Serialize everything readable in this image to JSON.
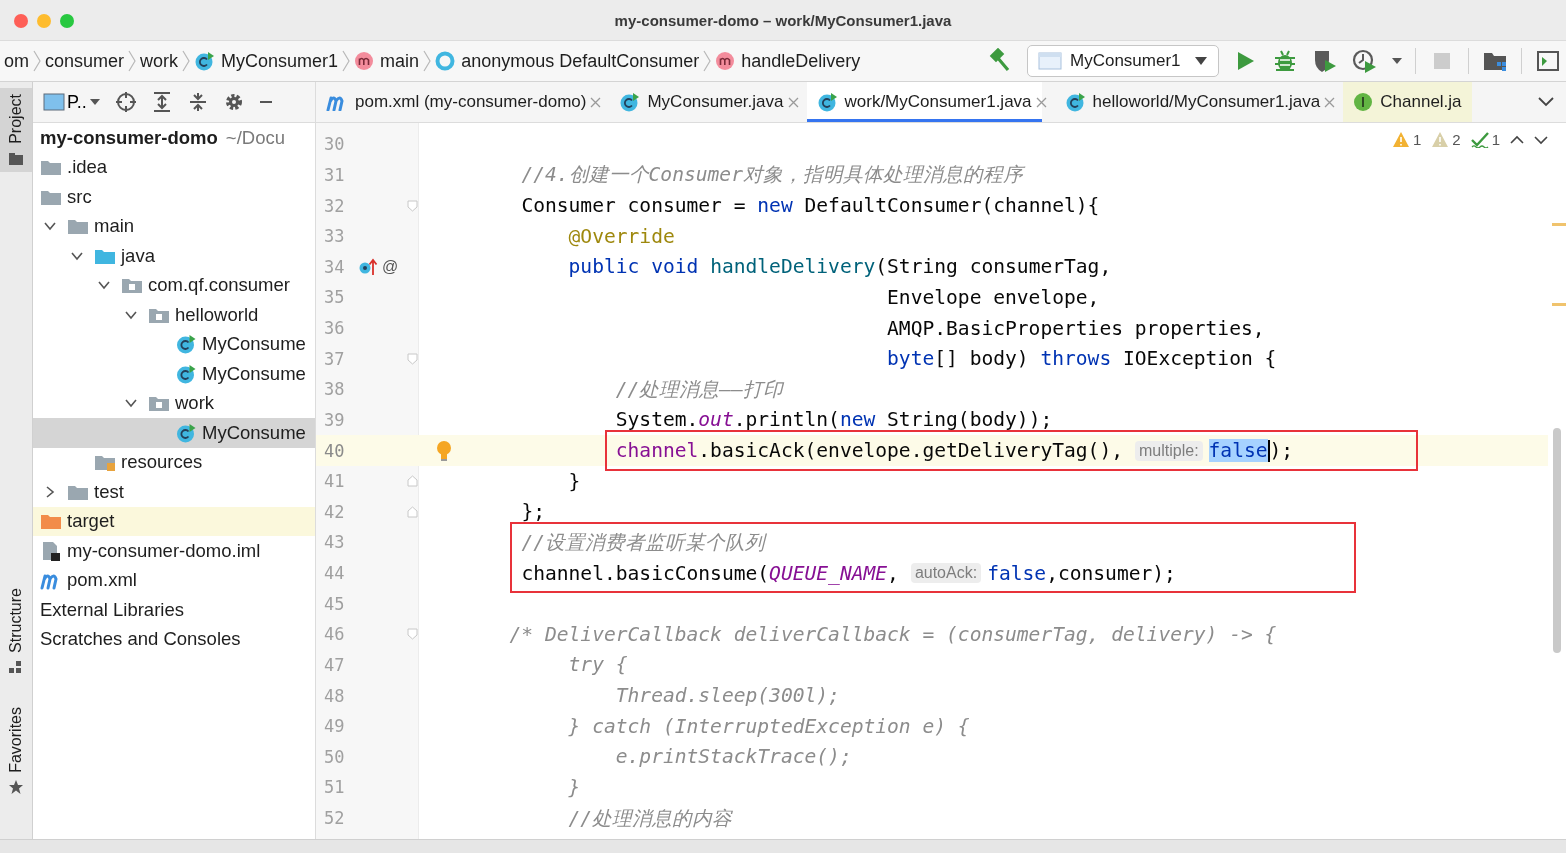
{
  "window": {
    "title": "my-consumer-domo – work/MyConsumer1.java"
  },
  "navigation_bar": {
    "breadcrumbs": [
      {
        "label": "om",
        "kind": "plain"
      },
      {
        "label": "consumer",
        "kind": "plain"
      },
      {
        "label": "work",
        "kind": "plain"
      },
      {
        "label": "MyConsumer1",
        "kind": "class"
      },
      {
        "label": "main",
        "kind": "method"
      },
      {
        "label": "anonymous DefaultConsumer",
        "kind": "anonymous"
      },
      {
        "label": "handleDelivery",
        "kind": "method"
      }
    ],
    "run_configuration": {
      "label": "MyConsumer1"
    },
    "toolbar_buttons": [
      {
        "kind": "build",
        "disabled": false
      },
      {
        "kind": "config"
      },
      {
        "kind": "run",
        "disabled": false
      },
      {
        "kind": "debug",
        "disabled": false
      },
      {
        "kind": "coverage",
        "disabled": false
      },
      {
        "kind": "profile",
        "disabled": false
      },
      {
        "kind": "stop",
        "disabled": true
      },
      {
        "kind": "project-structure",
        "disabled": false
      },
      {
        "kind": "panel",
        "disabled": false
      }
    ]
  },
  "tool_window_stripe": [
    {
      "label": "Project",
      "selected": true
    },
    {
      "label": "Structure",
      "selected": false
    },
    {
      "label": "Favorites",
      "selected": false
    }
  ],
  "project_panel": {
    "view_selector": "P..",
    "tree": [
      {
        "label": "my-consumer-domo",
        "path": "~/Docu",
        "selected": false,
        "children": [
          {
            "label": ".idea",
            "kind": "folder",
            "selected": false
          },
          {
            "label": "src",
            "kind": "folder",
            "selected": false,
            "children": [
              {
                "label": "main",
                "kind": "folder",
                "expanded": true,
                "selected": false,
                "children": [
                  {
                    "label": "java",
                    "kind": "source-folder",
                    "expanded": true,
                    "selected": false,
                    "children": [
                      {
                        "label": "com.qf.consumer",
                        "kind": "package",
                        "expanded": true,
                        "selected": false,
                        "children": [
                          {
                            "label": "helloworld",
                            "kind": "package",
                            "expanded": true,
                            "selected": false,
                            "children": [
                              {
                                "label": "MyConsume",
                                "kind": "class",
                                "selected": false
                              },
                              {
                                "label": "MyConsume",
                                "kind": "class",
                                "selected": false
                              }
                            ]
                          },
                          {
                            "label": "work",
                            "kind": "package",
                            "expanded": true,
                            "selected": false,
                            "children": [
                              {
                                "label": "MyConsume",
                                "kind": "class",
                                "selected": true
                              }
                            ]
                          }
                        ]
                      }
                    ]
                  },
                  {
                    "label": "resources",
                    "kind": "resources-folder",
                    "selected": false
                  }
                ]
              },
              {
                "label": "test",
                "kind": "folder",
                "expanded": false,
                "selected": false
              }
            ]
          },
          {
            "label": "target",
            "kind": "excluded-folder",
            "selected": false
          },
          {
            "label": "my-consumer-domo.iml",
            "kind": "module-file",
            "selected": false
          },
          {
            "label": "pom.xml",
            "kind": "maven-file",
            "selected": false
          }
        ]
      },
      {
        "label": "External Libraries",
        "selected": false
      },
      {
        "label": "Scratches and Consoles",
        "selected": false
      }
    ]
  },
  "editor": {
    "tabs": [
      {
        "label": "pom.xml (my-consumer-domo)",
        "kind": "maven",
        "selected": false,
        "closable": true
      },
      {
        "label": "MyConsumer.java",
        "kind": "class",
        "selected": false,
        "closable": true
      },
      {
        "label": "work/MyConsumer1.java",
        "kind": "class",
        "selected": true,
        "closable": true
      },
      {
        "label": "helloworld/MyConsumer1.java",
        "kind": "class",
        "selected": false,
        "closable": true
      },
      {
        "label": "Channel.ja",
        "kind": "interface",
        "selected": false,
        "closable": false
      }
    ],
    "inspections": [
      {
        "kind": "warning",
        "count": "1"
      },
      {
        "kind": "weak-warning",
        "count": "2"
      },
      {
        "kind": "typo",
        "count": "1"
      }
    ],
    "lines": [
      {
        "number": "30"
      },
      {
        "number": "31",
        "segments": [
          {
            "kind": "comment",
            "text": "        //4.创建一个Consumer对象，指明具体处理消息的程序"
          }
        ]
      },
      {
        "number": "32",
        "fold_open": true,
        "segments": [
          {
            "kind": "plain",
            "text": "        Consumer consumer = "
          },
          {
            "kind": "keyword",
            "text": "new"
          },
          {
            "kind": "plain",
            "text": " DefaultConsumer(channel){"
          }
        ]
      },
      {
        "number": "33",
        "segments": [
          {
            "kind": "annotation",
            "text": "            @Override"
          }
        ]
      },
      {
        "number": "34",
        "override": true,
        "mark": "@",
        "segments": [
          {
            "kind": "keyword",
            "text": "            public void "
          },
          {
            "kind": "method",
            "text": "handleDelivery"
          },
          {
            "kind": "plain",
            "text": "(String consumerTag,"
          }
        ]
      },
      {
        "number": "35",
        "segments": [
          {
            "kind": "plain",
            "text": "                                       Envelope envelope,"
          }
        ]
      },
      {
        "number": "36",
        "segments": [
          {
            "kind": "plain",
            "text": "                                       AMQP.BasicProperties properties,"
          }
        ]
      },
      {
        "number": "37",
        "fold_open": true,
        "segments": [
          {
            "kind": "keyword",
            "text": "                                       byte"
          },
          {
            "kind": "plain",
            "text": "[] body) "
          },
          {
            "kind": "keyword",
            "text": "throws"
          },
          {
            "kind": "plain",
            "text": " IOException {"
          }
        ]
      },
      {
        "number": "38",
        "segments": [
          {
            "kind": "comment",
            "text": "                //处理消息——打印"
          }
        ]
      },
      {
        "number": "39",
        "segments": [
          {
            "kind": "plain",
            "text": "                System."
          },
          {
            "kind": "static-field",
            "text": "out"
          },
          {
            "kind": "plain",
            "text": ".println("
          },
          {
            "kind": "keyword",
            "text": "new"
          },
          {
            "kind": "plain",
            "text": " String(body));"
          }
        ]
      },
      {
        "number": "40",
        "current": true,
        "bulb": true,
        "boxed": true,
        "segments": [
          {
            "kind": "field",
            "text": "                channel"
          },
          {
            "kind": "plain",
            "text": ".basicAck(envelope.getDeliveryTag(),"
          },
          {
            "kind": "hint",
            "text": "multiple:"
          },
          {
            "kind": "selected",
            "text": "false"
          },
          {
            "kind": "caret"
          },
          {
            "kind": "plain",
            "text": ");"
          }
        ]
      },
      {
        "number": "41",
        "fold_close": true,
        "segments": [
          {
            "kind": "plain",
            "text": "            }"
          }
        ]
      },
      {
        "number": "42",
        "fold_close": true,
        "segments": [
          {
            "kind": "plain",
            "text": "        };"
          }
        ]
      },
      {
        "number": "43",
        "boxed": true,
        "segments": [
          {
            "kind": "comment",
            "text": "        //设置消费者监听某个队列"
          }
        ]
      },
      {
        "number": "44",
        "boxed": true,
        "segments": [
          {
            "kind": "plain",
            "text": "        channel.basicConsume("
          },
          {
            "kind": "static-field",
            "text": "QUEUE_NAME"
          },
          {
            "kind": "plain",
            "text": ","
          },
          {
            "kind": "hint",
            "text": "autoAck:"
          },
          {
            "kind": "keyword",
            "text": "false"
          },
          {
            "kind": "plain",
            "text": ",consumer);"
          }
        ]
      },
      {
        "number": "45"
      },
      {
        "number": "46",
        "fold_open": true,
        "segments": [
          {
            "kind": "block-comment",
            "text": "       /* DeliverCallback deliverCallback = (consumerTag, delivery) -> {"
          }
        ]
      },
      {
        "number": "47",
        "segments": [
          {
            "kind": "block-comment",
            "text": "            try {"
          }
        ]
      },
      {
        "number": "48",
        "segments": [
          {
            "kind": "block-comment",
            "text": "                Thread.sleep(300l);"
          }
        ]
      },
      {
        "number": "49",
        "segments": [
          {
            "kind": "block-comment",
            "text": "            } catch (InterruptedException e) {"
          }
        ]
      },
      {
        "number": "50",
        "segments": [
          {
            "kind": "block-comment",
            "text": "                e.printStackTrace();"
          }
        ]
      },
      {
        "number": "51",
        "segments": [
          {
            "kind": "block-comment",
            "text": "            }"
          }
        ]
      },
      {
        "number": "52",
        "segments": [
          {
            "kind": "block-comment",
            "text": "            //处理消息的内容"
          }
        ]
      }
    ]
  }
}
